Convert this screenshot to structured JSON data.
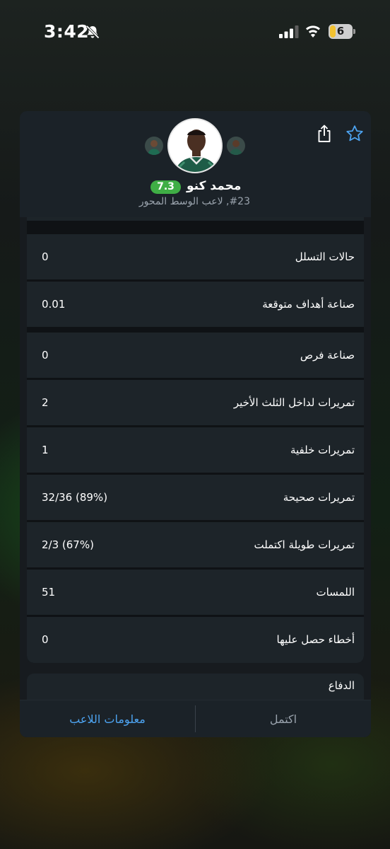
{
  "status_bar": {
    "time": "3:42",
    "battery": "6"
  },
  "player": {
    "name": "محمد كنو",
    "rating": "7.3",
    "subtitle": "#23, لاعب الوسط المحور"
  },
  "stats": [
    {
      "label": "حالات التسلل",
      "value": "0"
    },
    {
      "label": "صناعة أهداف متوقعة",
      "value": "0.01"
    },
    {
      "label": "صناعة فرص",
      "value": "0"
    },
    {
      "label": "تمريرات لداخل الثلث الأخير",
      "value": "2"
    },
    {
      "label": "تمريرات خلفية",
      "value": "1"
    },
    {
      "label": "تمريرات صحيحة",
      "value": "32/36 (89%)"
    },
    {
      "label": "تمريرات طويلة اكتملت",
      "value": "2/3 (67%)"
    },
    {
      "label": "اللمسات",
      "value": "51"
    },
    {
      "label": "أخطاء حصل عليها",
      "value": "0"
    }
  ],
  "next_section": {
    "title": "الدفاع"
  },
  "tabs": {
    "player_info": "معلومات اللاعب",
    "complete": "اكتمل"
  },
  "colors": {
    "accent": "#4da3f0",
    "rating_green": "#3fae45"
  },
  "icons": {
    "star": "star-icon",
    "share": "share-icon",
    "bell": "bell-slash-icon"
  }
}
